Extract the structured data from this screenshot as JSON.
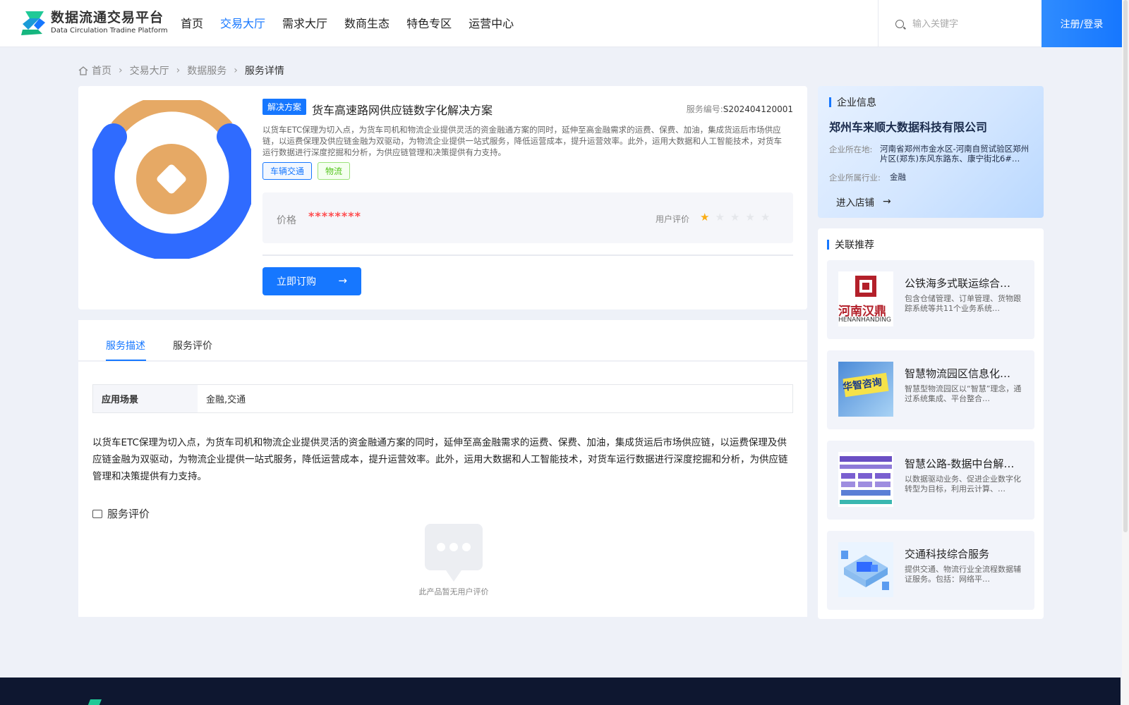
{
  "header": {
    "logo_title": "数据流通交易平台",
    "logo_subtitle": "Data Circulation Tradine Platform",
    "nav": [
      "首页",
      "交易大厅",
      "需求大厅",
      "数商生态",
      "特色专区",
      "运营中心"
    ],
    "nav_active_index": 1,
    "search_placeholder": "输入关键字",
    "login_label": "注册/登录"
  },
  "breadcrumb": {
    "items": [
      "首页",
      "交易大厅",
      "数据服务",
      "服务详情"
    ],
    "separator": "›"
  },
  "product": {
    "type_tag": "解决方案",
    "title": "货车高速路网供应链数字化解决方案",
    "serial_label": "服务编号:",
    "serial_value": "S202404120001",
    "description": "以货车ETC保理为切入点，为货车司机和物流企业提供灵活的资金融通方案的同时，延伸至高金融需求的运费、保费、加油，集成货运后市场供应链，以运费保理及供应链金融为双驱动，为物流企业提供一站式服务，降低运营成本，提升运营效率。此外，运用大数据和人工智能技术，对货车运行数据进行深度挖掘和分析，为供应链管理和决策提供有力支持。",
    "tags": [
      "车辆交通",
      "物流"
    ],
    "price_label": "价格",
    "price_value": "********",
    "rating_label": "用户评价",
    "rating": 1,
    "rating_max": 5,
    "buy_label": "立即订购",
    "buy_arrow": "→"
  },
  "detail": {
    "tabs": [
      "服务描述",
      "服务评价"
    ],
    "active_tab": 0,
    "scene_key": "应用场景",
    "scene_value": "金融,交通",
    "text": "以货车ETC保理为切入点，为货车司机和物流企业提供灵活的资金融通方案的同时，延伸至高金融需求的运费、保费、加油，集成货运后市场供应链，以运费保理及供应链金融为双驱动，为物流企业提供一站式服务，降低运营成本，提升运营效率。此外，运用大数据和人工智能技术，对货车运行数据进行深度挖掘和分析，为供应链管理和决策提供有力支持。",
    "review_title": "服务评价",
    "empty_text": "此产品暂无用户评价"
  },
  "company": {
    "section_title": "企业信息",
    "name": "郑州车来顺大数据科技有限公司",
    "location_label": "企业所在地:",
    "location_value": "河南省郑州市金水区-河南自贸试验区郑州片区(郑东)东风东路东、康宁街北6#…",
    "industry_label": "企业所属行业:",
    "industry_value": "金融",
    "shop_label": "进入店铺",
    "shop_arrow": "→"
  },
  "recommend": {
    "section_title": "关联推荐",
    "items": [
      {
        "title": "公铁海多式联运综合…",
        "desc": "包含仓储管理、订单管理、货物跟踪系统等共11个业务系统…",
        "thumb_text": "河南汉鼎",
        "thumb_sub": "HENANHANDING"
      },
      {
        "title": "智慧物流园区信息化…",
        "desc": "智慧型物流园区以“智慧”理念，通过系统集成、平台整合…",
        "thumb_text": "华智咨询"
      },
      {
        "title": "智慧公路-数据中台解…",
        "desc": "以数据驱动业务、促进企业数字化转型为目标，利用云计算、…"
      },
      {
        "title": "交通科技综合服务",
        "desc": "提供交通、物流行业全流程数据辅证服务。包括：网络平…"
      }
    ]
  },
  "colors": {
    "primary": "#1677ff",
    "price": "#ff4d4f",
    "star": "#faad14",
    "product_ring_blue": "#2f6bff",
    "product_ring_orange": "#e6a965"
  }
}
